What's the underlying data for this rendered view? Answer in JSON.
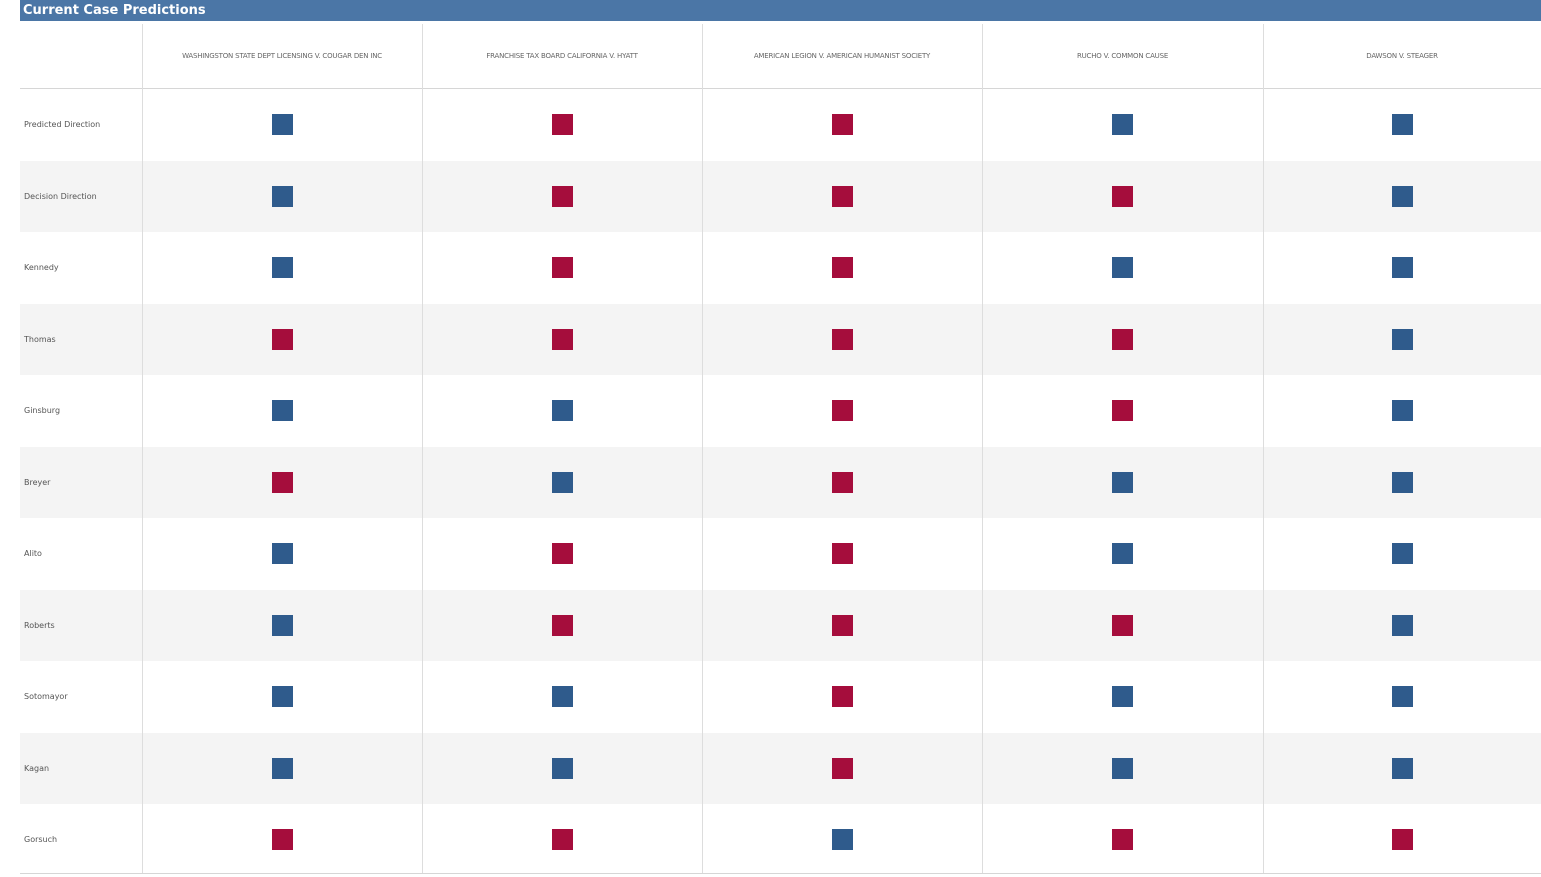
{
  "title": "Current Case Predictions",
  "colors": {
    "blue": "#2f5b8c",
    "red": "#a50d3c",
    "title_bar": "#4b76a6"
  },
  "chart_data": {
    "type": "heatmap",
    "title": "Current Case Predictions",
    "columns": [
      "WASHINGSTON STATE DEPT LICENSING V. COUGAR DEN INC",
      "FRANCHISE TAX BOARD CALIFORNIA V. HYATT",
      "AMERICAN LEGION V. AMERICAN HUMANIST SOCIETY",
      "RUCHO V. COMMON CAUSE",
      "DAWSON V. STEAGER"
    ],
    "rows": [
      {
        "label": "Predicted Direction",
        "values": [
          "blue",
          "red",
          "red",
          "blue",
          "blue"
        ]
      },
      {
        "label": "Decision Direction",
        "values": [
          "blue",
          "red",
          "red",
          "red",
          "blue"
        ]
      },
      {
        "label": "Kennedy",
        "values": [
          "blue",
          "red",
          "red",
          "blue",
          "blue"
        ]
      },
      {
        "label": "Thomas",
        "values": [
          "red",
          "red",
          "red",
          "red",
          "blue"
        ]
      },
      {
        "label": "Ginsburg",
        "values": [
          "blue",
          "blue",
          "red",
          "red",
          "blue"
        ]
      },
      {
        "label": "Breyer",
        "values": [
          "red",
          "blue",
          "red",
          "blue",
          "blue"
        ]
      },
      {
        "label": "Alito",
        "values": [
          "blue",
          "red",
          "red",
          "blue",
          "blue"
        ]
      },
      {
        "label": "Roberts",
        "values": [
          "blue",
          "red",
          "red",
          "red",
          "blue"
        ]
      },
      {
        "label": "Sotomayor",
        "values": [
          "blue",
          "blue",
          "red",
          "blue",
          "blue"
        ]
      },
      {
        "label": "Kagan",
        "values": [
          "blue",
          "blue",
          "red",
          "blue",
          "blue"
        ]
      },
      {
        "label": "Gorsuch",
        "values": [
          "red",
          "red",
          "blue",
          "red",
          "red"
        ]
      }
    ]
  }
}
